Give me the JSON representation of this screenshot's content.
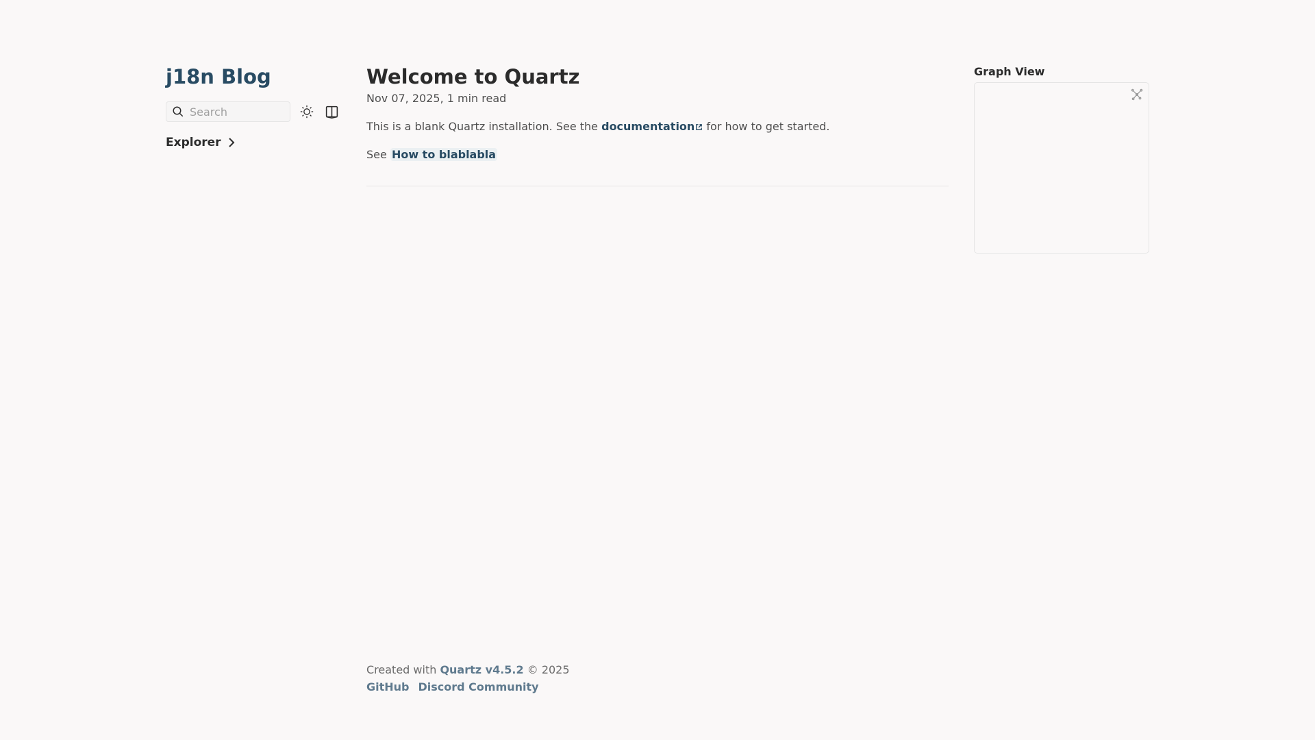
{
  "site": {
    "title": "j18n Blog"
  },
  "search": {
    "placeholder": "Search"
  },
  "explorer": {
    "label": "Explorer"
  },
  "article": {
    "title": "Welcome to Quartz",
    "date": "Nov 07, 2025",
    "read_time": "1 min read",
    "para1_before": "This is a blank Quartz installation. See the ",
    "para1_link": "documentation",
    "para1_after": " for how to get started.",
    "para2_before": "See ",
    "para2_link": "How to blablabla"
  },
  "graph": {
    "title": "Graph View"
  },
  "footer": {
    "created_with": "Created with ",
    "quartz_link": "Quartz v4.5.2",
    "copyright": " © 2025",
    "links": [
      "GitHub",
      "Discord Community"
    ]
  },
  "colors": {
    "accent": "#284b63",
    "background": "#faf8f8",
    "footer_link": "#5f7a8e"
  }
}
